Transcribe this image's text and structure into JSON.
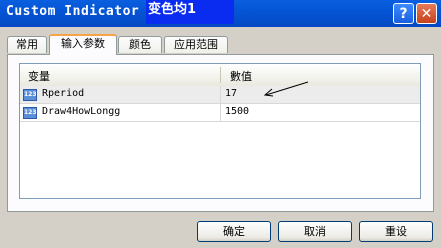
{
  "window": {
    "title": "Custom Indicator -",
    "title_suffix": "变色均1",
    "help_symbol": "?",
    "close_symbol": "✕"
  },
  "tabs": [
    {
      "label": "常用",
      "active": false
    },
    {
      "label": "输入参数",
      "active": true
    },
    {
      "label": "颜色",
      "active": false
    },
    {
      "label": "应用范围",
      "active": false
    }
  ],
  "grid": {
    "headers": {
      "variable": "变量",
      "value": "數值"
    },
    "rows": [
      {
        "icon": "123",
        "name": "Rperiod",
        "value": "17"
      },
      {
        "icon": "123",
        "name": "Draw4HowLongg",
        "value": "1500"
      }
    ]
  },
  "buttons": {
    "ok": "确定",
    "cancel": "取消",
    "reset": "重设"
  }
}
